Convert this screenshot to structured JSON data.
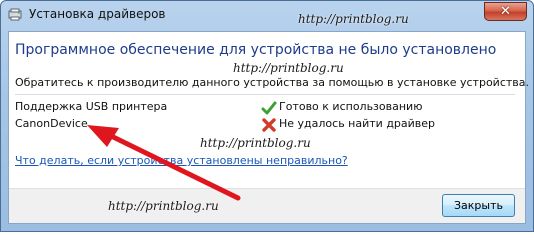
{
  "window": {
    "title": "Установка драйверов",
    "close_glyph": "✕"
  },
  "main": {
    "heading": "Программное обеспечение для устройства не было установлено",
    "instructions": "Обратитесь к производителю данного устройства за помощью в установке устройства.",
    "devices": [
      {
        "name": "Поддержка USB принтера",
        "status": "Готово к использованию",
        "status_icon": "check-icon"
      },
      {
        "name": "CanonDevice",
        "status": "Не удалось найти драйвер",
        "status_icon": "error-x-icon"
      }
    ],
    "help_link": "Что делать, если устройства установлены неправильно?"
  },
  "footer": {
    "close_button": "Закрыть"
  },
  "watermarks": [
    "http://printblog.ru",
    "http://printblog.ru",
    "http://printblog.ru",
    "http://printblog.ru"
  ],
  "colors": {
    "heading": "#1d3c8c",
    "link": "#1a56b8",
    "check": "#3aa12c",
    "error": "#d23a2a",
    "annotation_arrow": "#e0161e"
  }
}
